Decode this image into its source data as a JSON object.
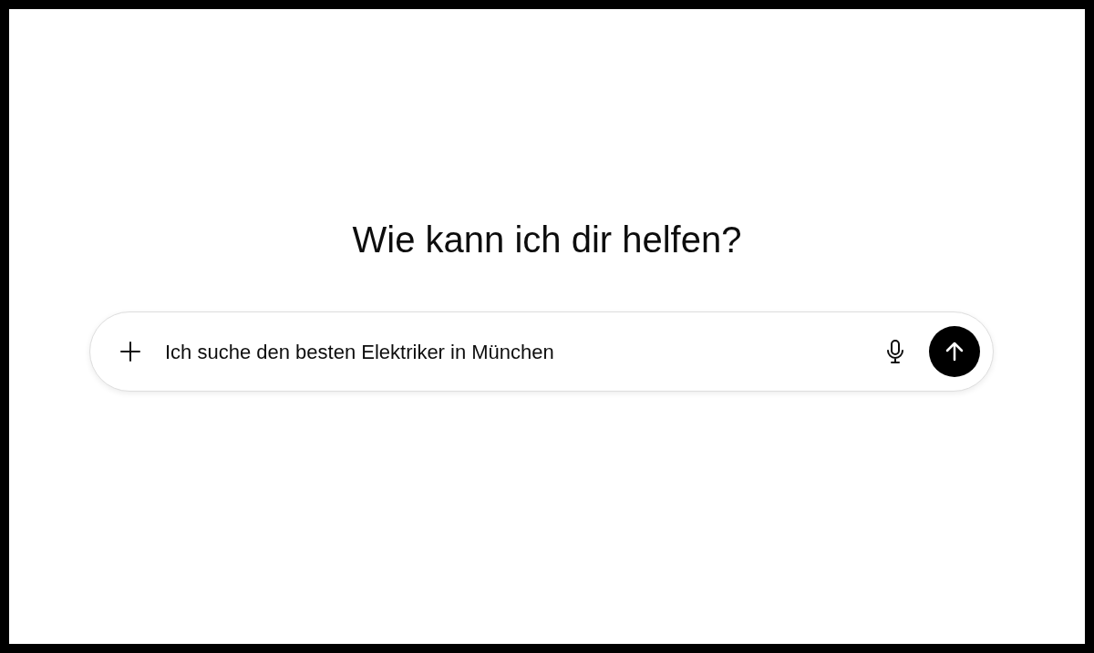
{
  "heading": "Wie kann ich dir helfen?",
  "prompt": {
    "value": "Ich suche den besten Elektriker in München"
  }
}
